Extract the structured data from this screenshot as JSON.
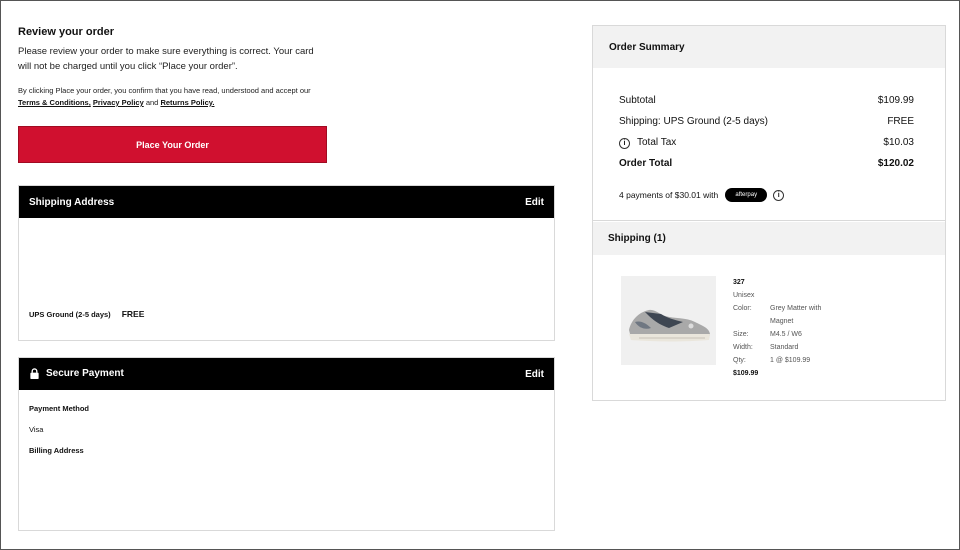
{
  "review": {
    "title": "Review your order",
    "text": "Please review your order to make sure everything is correct. Your card will not be charged until you click “Place your order”.",
    "terms_prefix": "By clicking Place your order, you confirm that you have read, understood and accept our",
    "terms_link": "Terms & Conditions,",
    "privacy_link": "Privacy Policy",
    "and_text": "and",
    "returns_link": "Returns Policy.",
    "place_order_label": "Place Your Order"
  },
  "shipping_address": {
    "title": "Shipping Address",
    "edit_label": "Edit",
    "method": "UPS Ground (2-5 days)",
    "method_price": "FREE"
  },
  "payment": {
    "title": "Secure Payment",
    "edit_label": "Edit",
    "method_label": "Payment Method",
    "method_value": "Visa",
    "billing_label": "Billing Address"
  },
  "summary": {
    "title": "Order Summary",
    "rows": [
      {
        "label": "Subtotal",
        "value": "$109.99"
      },
      {
        "label": "Shipping: UPS Ground (2-5 days)",
        "value": "FREE"
      },
      {
        "label": "Total Tax",
        "value": "$10.03"
      },
      {
        "label": "Order Total",
        "value": "$120.02"
      }
    ],
    "afterpay_text": "4 payments of $30.01 with",
    "afterpay_badge": "afterpay",
    "shipping_title": "Shipping (1)"
  },
  "product": {
    "name": "327",
    "gender": "Unisex",
    "color_label": "Color:",
    "color_value": "Grey Matter with Magnet",
    "size_label": "Size:",
    "size_value": "M4.5 / W6",
    "width_label": "Width:",
    "width_value": "Standard",
    "qty_label": "Qty:",
    "qty_value": "1 @ $109.99",
    "price": "$109.99"
  },
  "colors": {
    "accent": "#d0102f",
    "header_bg": "#000000",
    "summary_bg": "#f2f2f2"
  }
}
